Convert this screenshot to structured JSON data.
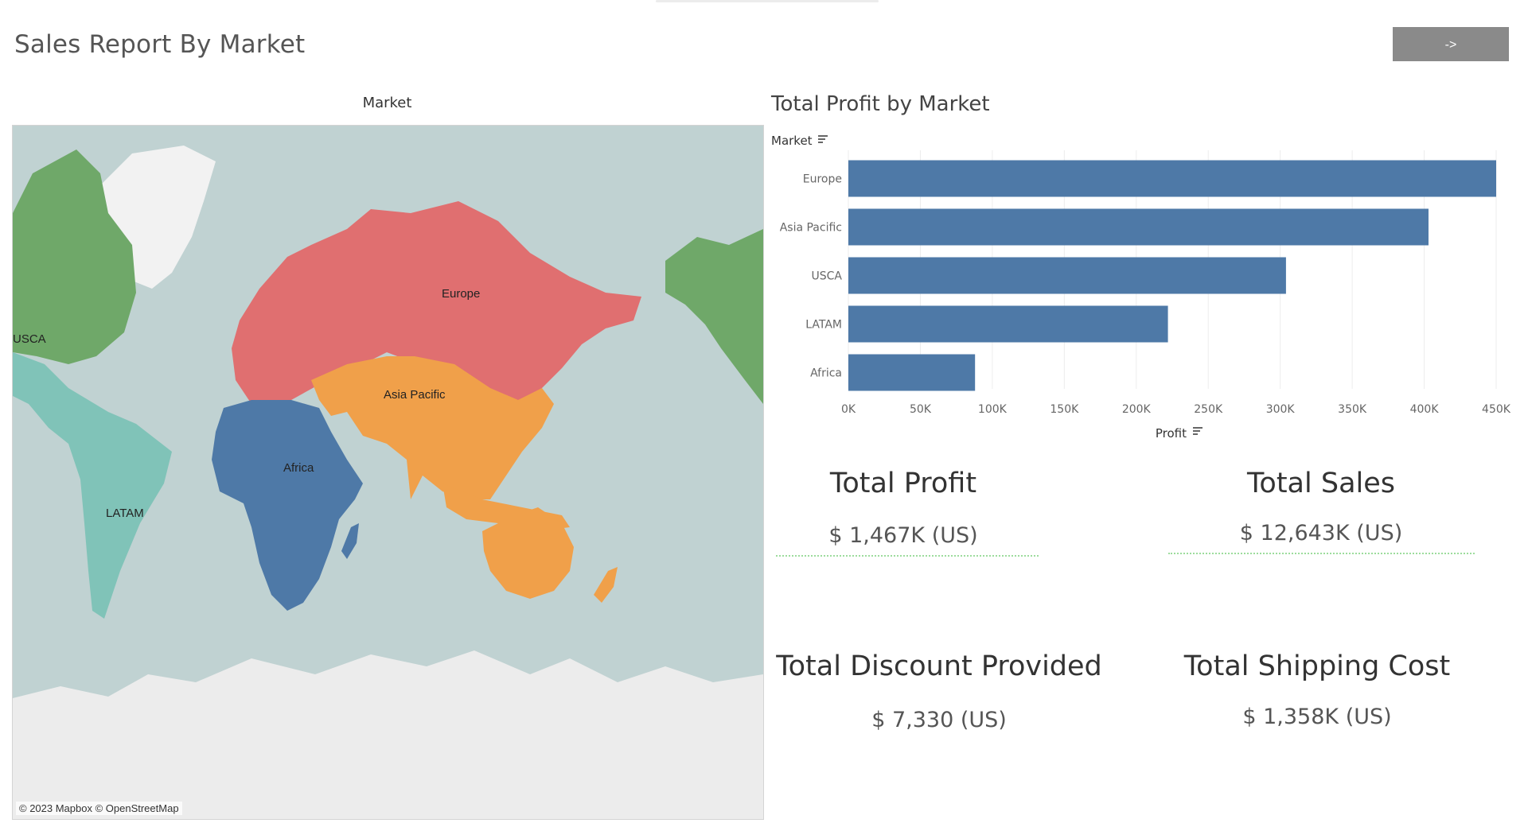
{
  "page": {
    "title": "Sales Report By Market",
    "nav_button_label": "->"
  },
  "map": {
    "title": "Market",
    "attribution": "© 2023 Mapbox © OpenStreetMap",
    "regions": [
      {
        "name": "USCA",
        "color": "#6fa869",
        "label": "USCA"
      },
      {
        "name": "LATAM",
        "color": "#80c3b8",
        "label": "LATAM"
      },
      {
        "name": "Europe",
        "color": "#e06f70",
        "label": "Europe"
      },
      {
        "name": "Asia Pacific",
        "color": "#f0a04a",
        "label": "Asia Pacific"
      },
      {
        "name": "Africa",
        "color": "#4e79a7",
        "label": "Africa"
      }
    ],
    "colors": {
      "ocean": "#c0d2d2",
      "ice": "#ececec",
      "greenland": "#f2f2f2"
    }
  },
  "chart_data": {
    "type": "bar",
    "orientation": "horizontal",
    "title": "Total Profit by Market",
    "categories": [
      "Europe",
      "Asia Pacific",
      "USCA",
      "LATAM",
      "Africa"
    ],
    "values": [
      450000,
      403000,
      304000,
      222000,
      88000
    ],
    "xlabel": "Profit",
    "ylabel": "Market",
    "xlim": [
      0,
      450000
    ],
    "xticks": [
      "0K",
      "50K",
      "100K",
      "150K",
      "200K",
      "250K",
      "300K",
      "350K",
      "400K",
      "450K"
    ],
    "bar_color": "#4e79a7",
    "grid": true
  },
  "kpis": [
    {
      "title": "Total Profit",
      "value": "$ 1,467K (US)"
    },
    {
      "title": "Total Sales",
      "value": "$ 12,643K (US)"
    },
    {
      "title": "Total Discount Provided",
      "value": "$ 7,330 (US)"
    },
    {
      "title": "Total Shipping Cost",
      "value": "$ 1,358K (US)"
    }
  ]
}
